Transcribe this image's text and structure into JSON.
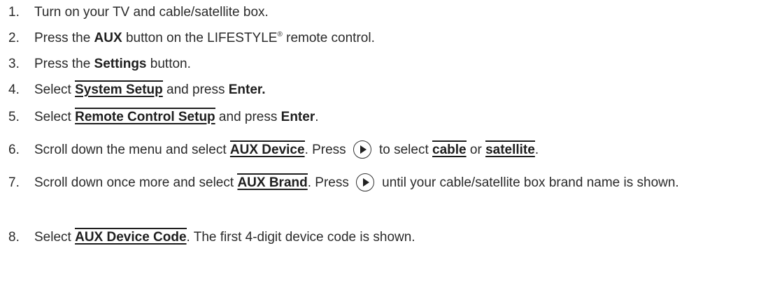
{
  "steps": [
    {
      "num": "1.",
      "t1": "Turn on your TV and cable/satellite box."
    },
    {
      "num": "2.",
      "t1": "Press the ",
      "b1": "AUX",
      "t2": " button on the LIFESTYLE",
      "reg": "®",
      "t3": " remote control."
    },
    {
      "num": "3.",
      "t1": "Press the ",
      "b1": "Settings",
      "t2": " button."
    },
    {
      "num": "4.",
      "t1": "Select ",
      "m1": "System Setup",
      "t2": " and press ",
      "b1": "Enter."
    },
    {
      "num": "5.",
      "t1": "Select ",
      "m1": "Remote Control Setup",
      "t2": " and press ",
      "b1": "Enter",
      "t3": "."
    },
    {
      "num": "6.",
      "t1": "Scroll down the menu and select ",
      "m1": "AUX Device",
      "t2": ". Press",
      "t3": " to select ",
      "m2": "cable",
      "t4": " or ",
      "m3": "satellite",
      "t5": "."
    },
    {
      "num": "7.",
      "t1": "Scroll down once more and select ",
      "m1": "AUX Brand",
      "t2": ". Press",
      "t3": " until your cable/satellite box brand name is shown."
    },
    {
      "num": "8.",
      "t1": "Select ",
      "m1": "AUX Device Code",
      "t2": ". The first 4-digit device code is shown."
    }
  ],
  "icons": {
    "right_arrow_button": "play-circle-icon"
  },
  "colors": {
    "text": "#2a2a2a",
    "emphasis": "#1e1e1e",
    "background": "#ffffff"
  }
}
